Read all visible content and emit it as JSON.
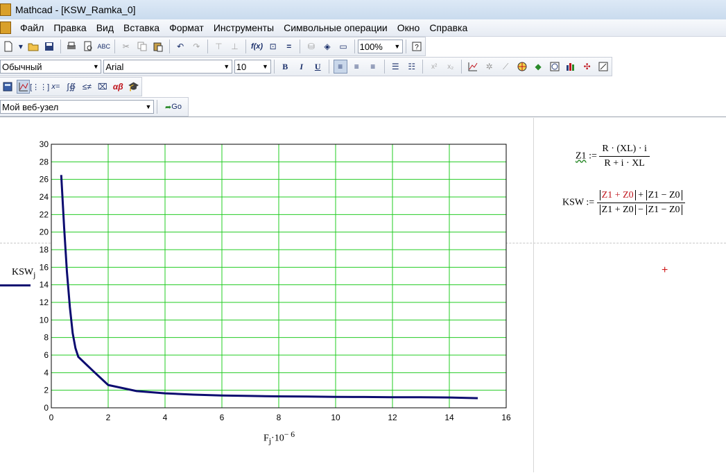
{
  "window": {
    "title": "Mathcad - [KSW_Ramka_0]"
  },
  "menu": [
    "Файл",
    "Правка",
    "Вид",
    "Вставка",
    "Формат",
    "Инструменты",
    "Символьные операции",
    "Окно",
    "Справка"
  ],
  "toolbar": {
    "zoom": "100%",
    "style": "Обычный",
    "font": "Arial",
    "size": "10",
    "bold": "B",
    "italic": "I",
    "underline": "U",
    "web_location": "Мой веб-узел",
    "go_label": "Go"
  },
  "equations": {
    "z1_name": "Z1",
    "assign": ":=",
    "z1_num": "R · (XL) · i",
    "z1_den": "R + i · XL",
    "ksw_name": "KSW",
    "ksw_num_a": "Z1 + Z0",
    "ksw_plus": "+",
    "ksw_num_b": "Z1 − Z0",
    "ksw_den_a": "Z1 + Z0",
    "ksw_minus": "−",
    "ksw_den_b": "Z1 − Z0"
  },
  "plot": {
    "legend_label": "KSW",
    "legend_sub": "j",
    "x_label": "F",
    "x_label_sub": "j",
    "x_label_tail": "·10",
    "x_label_exp": "− 6"
  },
  "chart_data": {
    "type": "line",
    "x_ticks": [
      "0",
      "2",
      "4",
      "6",
      "8",
      "10",
      "12",
      "14",
      "16"
    ],
    "y_ticks": [
      "0",
      "2",
      "4",
      "6",
      "8",
      "10",
      "12",
      "14",
      "16",
      "18",
      "20",
      "22",
      "24",
      "26",
      "28",
      "30"
    ],
    "xlim": [
      0,
      16
    ],
    "ylim": [
      0,
      30
    ],
    "grid": true,
    "series": [
      {
        "color": "#0c0c70",
        "x": [
          0.35,
          0.45,
          0.55,
          0.65,
          0.75,
          0.85,
          0.95,
          1.5,
          2.0,
          3.0,
          4.0,
          5.0,
          6.0,
          7.0,
          8.0,
          9.0,
          10.0,
          11.0,
          12.0,
          13.0,
          14.0,
          15.0
        ],
        "y": [
          26.5,
          20.5,
          15.5,
          11.5,
          8.5,
          6.8,
          5.8,
          4.1,
          2.6,
          1.9,
          1.65,
          1.5,
          1.4,
          1.35,
          1.3,
          1.28,
          1.25,
          1.23,
          1.21,
          1.2,
          1.18,
          1.1
        ]
      }
    ]
  }
}
